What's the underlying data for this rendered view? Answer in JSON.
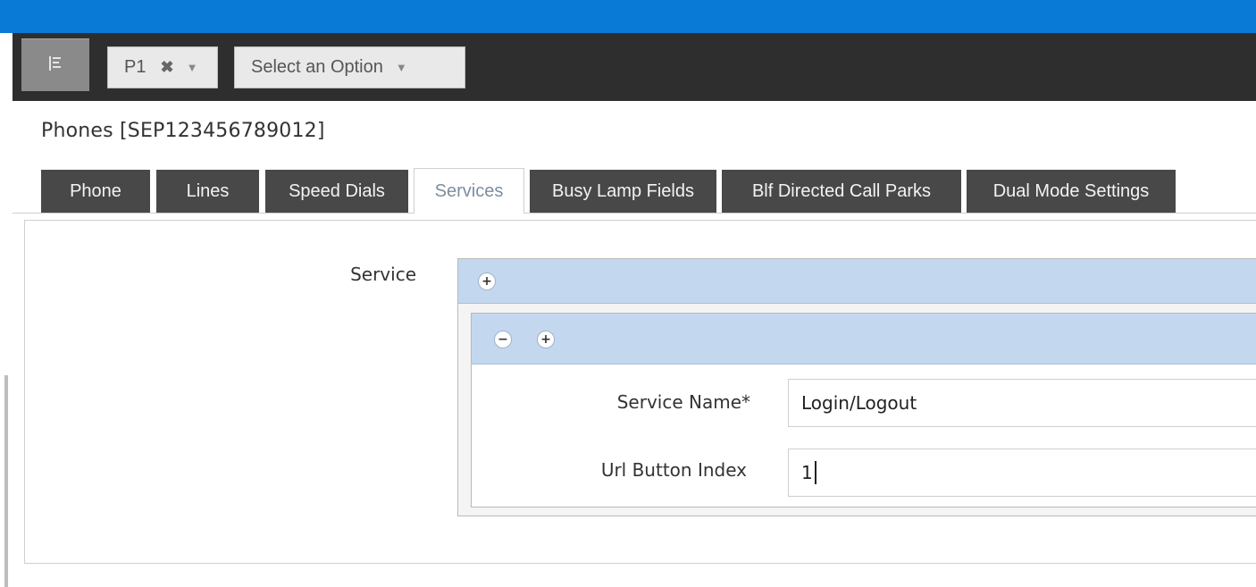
{
  "toolbar": {
    "menu_icon": "tree-menu-icon",
    "chip_p1": {
      "label": "P1",
      "remove_icon": "close-icon",
      "dropdown_icon": "caret-down-icon"
    },
    "chip_select": {
      "label": "Select an Option",
      "dropdown_icon": "caret-down-icon"
    }
  },
  "page": {
    "title": "Phones [SEP123456789012]"
  },
  "tabs": [
    {
      "label": "Phone",
      "active": false
    },
    {
      "label": "Lines",
      "active": false
    },
    {
      "label": "Speed Dials",
      "active": false
    },
    {
      "label": "Services",
      "active": true
    },
    {
      "label": "Busy Lamp Fields",
      "active": false
    },
    {
      "label": "Blf Directed Call Parks",
      "active": false
    },
    {
      "label": "Dual Mode Settings",
      "active": false
    }
  ],
  "form": {
    "service_label": "Service",
    "add_symbol": "+",
    "remove_symbol": "−",
    "service_name": {
      "label": "Service Name*",
      "value": "Login/Logout"
    },
    "url_button_index": {
      "label": "Url Button Index",
      "value": "1"
    }
  },
  "colors": {
    "topbar": "#0a7ad7",
    "toolbar": "#2e2e2e",
    "tab_dark": "#484848",
    "group_header": "#c3d8ef"
  }
}
